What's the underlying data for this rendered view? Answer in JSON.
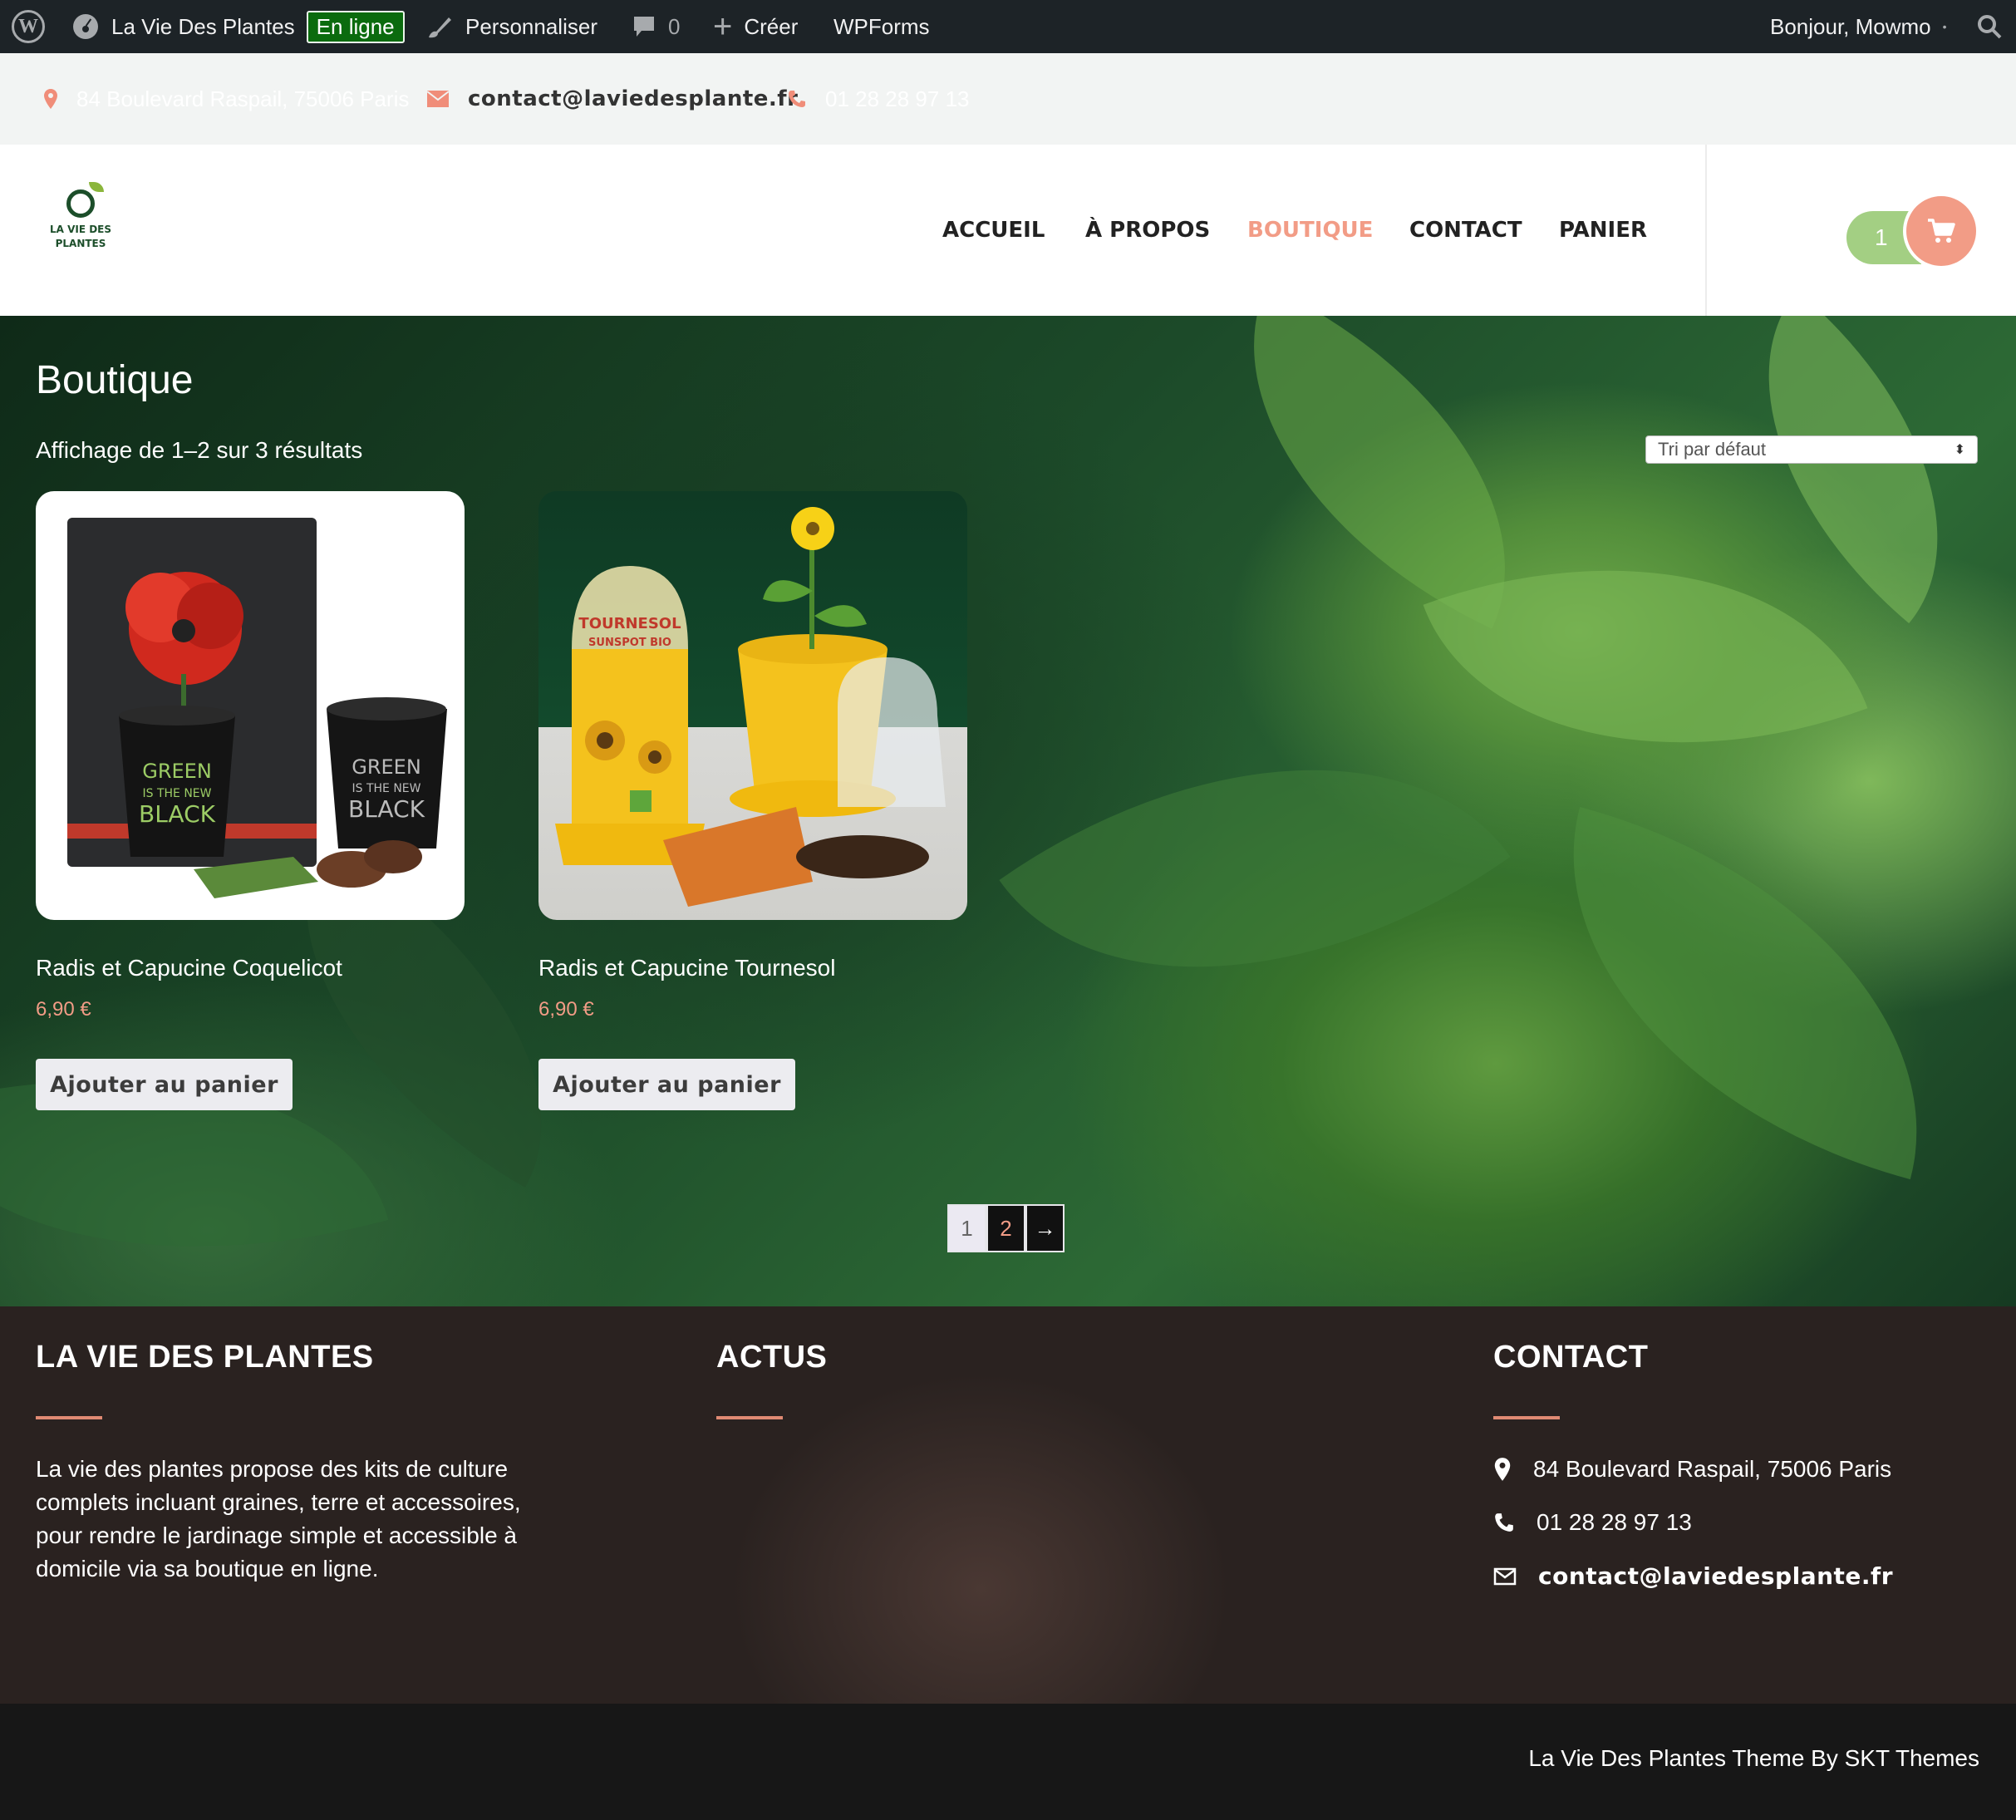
{
  "adminbar": {
    "site_name": "La Vie Des Plantes",
    "status_badge": "En ligne",
    "customize": "Personnaliser",
    "comments_count": "0",
    "create": "Créer",
    "wpforms": "WPForms",
    "greeting": "Bonjour, Mowmo"
  },
  "infobar": {
    "address": "84 Boulevard Raspail, 75006 Paris",
    "email": "contact@laviedesplante.fr",
    "phone": "01 28 28 97 13"
  },
  "header": {
    "logo_text_line1": "LA VIE DES",
    "logo_text_line2": "PLANTES",
    "nav": [
      "ACCUEIL",
      "À PROPOS",
      "BOUTIQUE",
      "CONTACT",
      "PANIER"
    ],
    "active_nav": "BOUTIQUE",
    "cart_count": "1"
  },
  "shop": {
    "title": "Boutique",
    "result_count": "Affichage de 1–2 sur 3 résultats",
    "sort_selected": "Tri par défaut",
    "products": [
      {
        "name": "Radis et Capucine Coquelicot",
        "price": "6,90 €",
        "button": "Ajouter au panier",
        "pot_text": [
          "GREEN",
          "IS THE NEW",
          "BLACK"
        ]
      },
      {
        "name": "Radis et Capucine Tournesol",
        "price": "6,90 €",
        "button": "Ajouter au panier",
        "pack_text": [
          "TOURNESOL",
          "SUNSPOT BIO"
        ]
      }
    ],
    "pagination": {
      "current": "1",
      "next_page": "2",
      "next_arrow": "→"
    }
  },
  "footer": {
    "col1_title": "LA VIE DES PLANTES",
    "col1_text": "La vie des plantes propose des kits de culture complets incluant graines, terre et accessoires, pour rendre le jardinage simple et accessible à domicile via sa boutique en ligne.",
    "col2_title": "ACTUS",
    "col3_title": "CONTACT",
    "address": "84 Boulevard Raspail, 75006 Paris",
    "phone": "01 28 28 97 13",
    "email": "contact@laviedesplante.fr",
    "credit": "La Vie Des Plantes Theme By SKT Themes"
  },
  "colors": {
    "accent": "#f29c86",
    "cart_green": "#a3cf83",
    "adminbar": "#1d2327",
    "footer": "#2a2220"
  },
  "icons": [
    "wordpress-icon",
    "dashboard-icon",
    "brush-icon",
    "comment-icon",
    "plus-icon",
    "search-icon",
    "map-pin-icon",
    "envelope-icon",
    "phone-icon",
    "cart-icon"
  ]
}
